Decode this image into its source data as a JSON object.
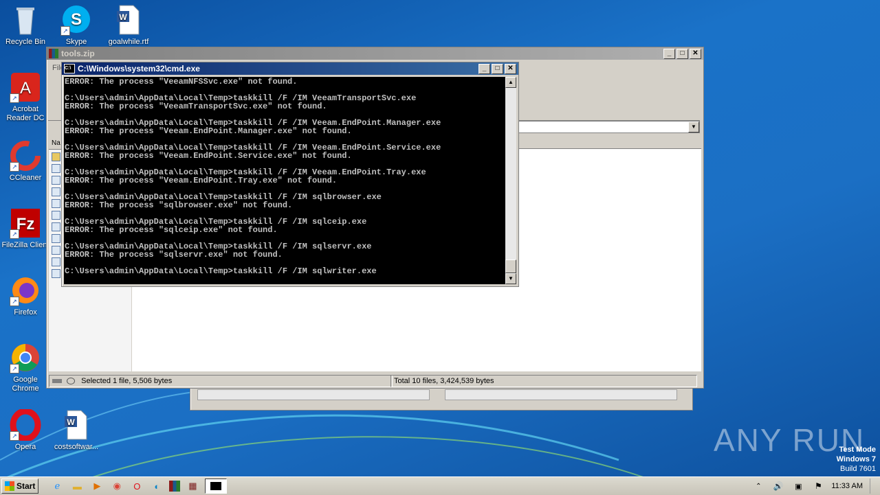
{
  "desktop": {
    "icons": [
      {
        "label": "Recycle Bin"
      },
      {
        "label": "Skype"
      },
      {
        "label": "goalwhile.rtf"
      },
      {
        "label": "Acrobat Reader DC"
      },
      {
        "label": "CCleaner"
      },
      {
        "label": "FileZilla Client"
      },
      {
        "label": "Firefox"
      },
      {
        "label": "Google Chrome"
      },
      {
        "label": "Opera"
      },
      {
        "label": "costsoftwar..."
      }
    ]
  },
  "winrar": {
    "title": "tools.zip",
    "menu_first": "File",
    "col_first": "Na",
    "status_left": "Selected 1 file, 5,506 bytes",
    "status_right": "Total 10 files, 3,424,539 bytes"
  },
  "cmd": {
    "title": "C:\\Windows\\system32\\cmd.exe",
    "lines": "ERROR: The process \"VeeamNFSSvc.exe\" not found.\n\nC:\\Users\\admin\\AppData\\Local\\Temp>taskkill /F /IM VeeamTransportSvc.exe\nERROR: The process \"VeeamTransportSvc.exe\" not found.\n\nC:\\Users\\admin\\AppData\\Local\\Temp>taskkill /F /IM Veeam.EndPoint.Manager.exe\nERROR: The process \"Veeam.EndPoint.Manager.exe\" not found.\n\nC:\\Users\\admin\\AppData\\Local\\Temp>taskkill /F /IM Veeam.EndPoint.Service.exe\nERROR: The process \"Veeam.EndPoint.Service.exe\" not found.\n\nC:\\Users\\admin\\AppData\\Local\\Temp>taskkill /F /IM Veeam.EndPoint.Tray.exe\nERROR: The process \"Veeam.EndPoint.Tray.exe\" not found.\n\nC:\\Users\\admin\\AppData\\Local\\Temp>taskkill /F /IM sqlbrowser.exe\nERROR: The process \"sqlbrowser.exe\" not found.\n\nC:\\Users\\admin\\AppData\\Local\\Temp>taskkill /F /IM sqlceip.exe\nERROR: The process \"sqlceip.exe\" not found.\n\nC:\\Users\\admin\\AppData\\Local\\Temp>taskkill /F /IM sqlservr.exe\nERROR: The process \"sqlservr.exe\" not found.\n\nC:\\Users\\admin\\AppData\\Local\\Temp>taskkill /F /IM sqlwriter.exe"
  },
  "taskbar": {
    "start_label": "Start",
    "clock": "11:33 AM"
  },
  "watermark": {
    "brand": "ANY RUN",
    "line1": "Test Mode",
    "line2": "Windows 7",
    "line3": "Build 7601"
  },
  "colors": {
    "title_active": "#0a246a",
    "title_inactive": "#808080",
    "desktop": "#1a6ac0"
  }
}
